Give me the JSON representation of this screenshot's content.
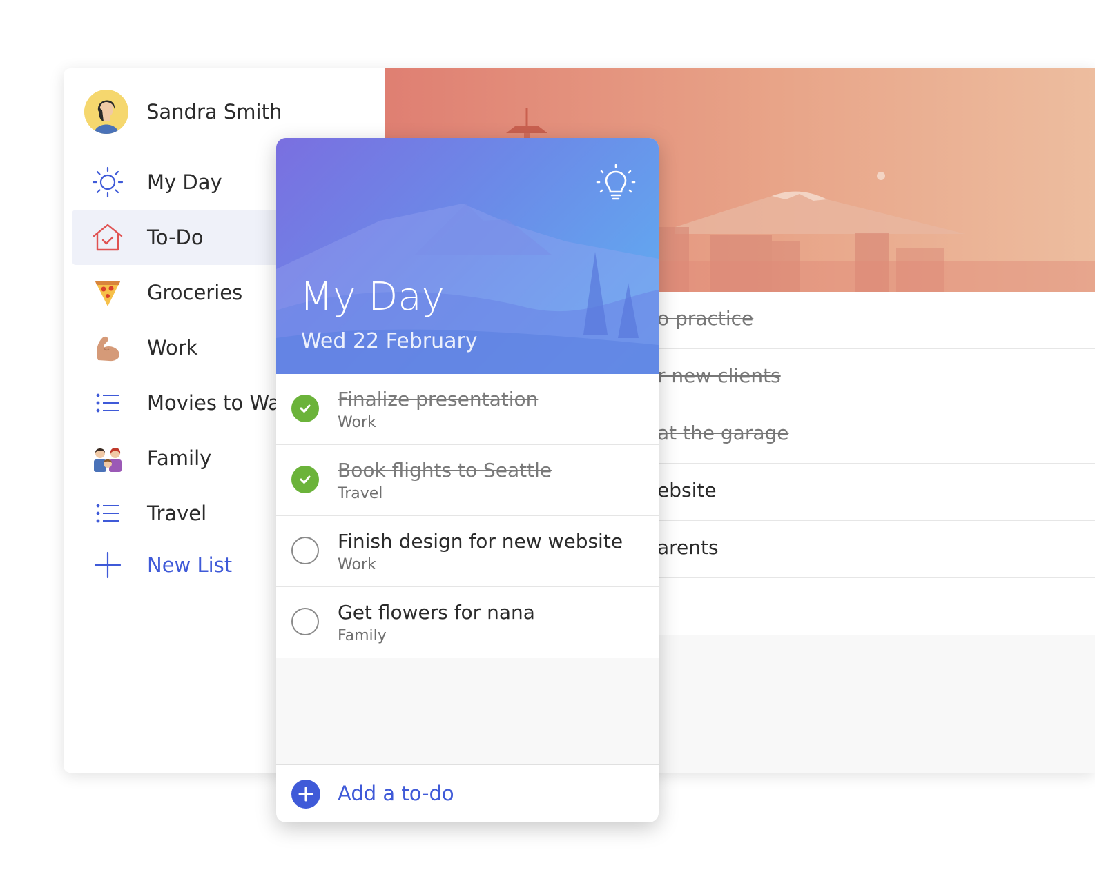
{
  "profile": {
    "name": "Sandra Smith",
    "avatar_icon": "user-avatar"
  },
  "sidebar": {
    "items": [
      {
        "label": "My Day",
        "icon": "sun-icon"
      },
      {
        "label": "To-Do",
        "icon": "house-check-icon",
        "active": true
      },
      {
        "label": "Groceries",
        "icon": "pizza-icon"
      },
      {
        "label": "Work",
        "icon": "flexed-biceps-icon"
      },
      {
        "label": "Movies to Wat",
        "icon": "list-icon"
      },
      {
        "label": "Family",
        "icon": "family-icon"
      },
      {
        "label": "Travel",
        "icon": "list-icon"
      },
      {
        "label": "New List",
        "icon": "plus-icon"
      }
    ]
  },
  "background_list": {
    "rows": [
      {
        "text": "o practice",
        "done": true
      },
      {
        "text": "r new clients",
        "done": true
      },
      {
        "text": "at the garage",
        "done": true
      },
      {
        "text": "ebsite",
        "done": false
      },
      {
        "text": "arents",
        "done": false
      }
    ]
  },
  "my_day": {
    "title": "My Day",
    "date": "Wed 22 February",
    "suggestions_icon": "lightbulb-icon",
    "tasks": [
      {
        "title": "Finalize presentation",
        "list": "Work",
        "done": true
      },
      {
        "title": "Book flights to Seattle",
        "list": "Travel",
        "done": true
      },
      {
        "title": "Finish design for new website",
        "list": "Work",
        "done": false
      },
      {
        "title": "Get flowers for nana",
        "list": "Family",
        "done": false
      }
    ],
    "add_label": "Add a to-do"
  },
  "colors": {
    "accent": "#3f5ad8",
    "done_green": "#6bb33a",
    "hero_blue_start": "#7a6fe0",
    "hero_blue_end": "#5fb2f2",
    "background_hero": "#e8a488"
  }
}
